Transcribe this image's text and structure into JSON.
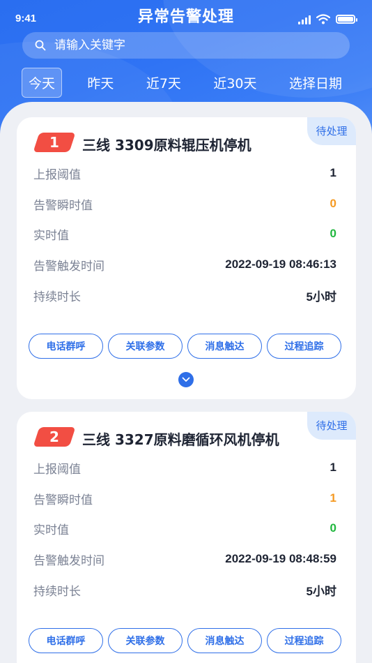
{
  "status_bar": {
    "time": "9:41"
  },
  "header": {
    "title": "异常告警处理"
  },
  "search": {
    "placeholder": "请输入关键字"
  },
  "tabs": [
    {
      "label": "今天",
      "active": true
    },
    {
      "label": "昨天"
    },
    {
      "label": "近7天"
    },
    {
      "label": "近30天"
    },
    {
      "label": "选择日期"
    }
  ],
  "alerts": [
    {
      "index": "1",
      "status": "待处理",
      "title": "三线 3309原料辊压机停机",
      "fields": [
        {
          "label": "上报阈值",
          "value": "1"
        },
        {
          "label": "告警瞬时值",
          "value": "0"
        },
        {
          "label": "实时值",
          "value": "0"
        },
        {
          "label": "告警触发时间",
          "value": "2022-09-19 08:46:13"
        },
        {
          "label": "持续时长",
          "value": "5小时"
        }
      ]
    },
    {
      "index": "2",
      "status": "待处理",
      "title": "三线 3327原料磨循环风机停机",
      "fields": [
        {
          "label": "上报阈值",
          "value": "1"
        },
        {
          "label": "告警瞬时值",
          "value": "1"
        },
        {
          "label": "实时值",
          "value": "0"
        },
        {
          "label": "告警触发时间",
          "value": "2022-09-19 08:48:59"
        },
        {
          "label": "持续时长",
          "value": "5小时"
        }
      ]
    }
  ],
  "actions": [
    "电话群呼",
    "关联参数",
    "消息触达",
    "过程追踪"
  ],
  "colors": {
    "primary": "#2f6fe8",
    "badge_red": "#f24e43",
    "value_orange": "#f59a23",
    "value_green": "#20b73e"
  }
}
